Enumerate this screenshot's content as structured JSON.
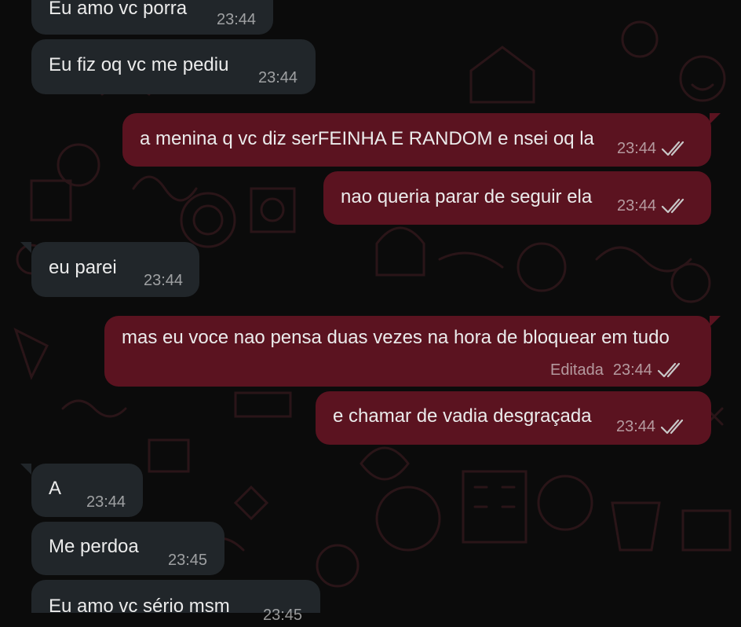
{
  "colors": {
    "background": "#0b0b0b",
    "incoming_bubble": "#21262a",
    "outgoing_bubble": "#5b1320",
    "text": "#ebebeb"
  },
  "chat": {
    "messages": [
      {
        "direction": "incoming",
        "text": "Eu amo vc porra",
        "time": "23:44"
      },
      {
        "direction": "incoming",
        "text": "Eu fiz oq vc me pediu",
        "time": "23:44"
      },
      {
        "direction": "outgoing",
        "text": "a menina q vc diz serFEINHA E RANDOM e nsei oq la",
        "time": "23:44",
        "status_icon": "double-check-icon"
      },
      {
        "direction": "outgoing",
        "text": "nao queria parar de seguir ela",
        "time": "23:44",
        "status_icon": "double-check-icon"
      },
      {
        "direction": "incoming",
        "text": "eu parei",
        "time": "23:44"
      },
      {
        "direction": "outgoing",
        "text": "mas eu voce nao pensa duas vezes na hora de bloquear em tudo",
        "edited_label": "Editada",
        "time": "23:44",
        "status_icon": "double-check-icon"
      },
      {
        "direction": "outgoing",
        "text": "e chamar de vadia desgraçada",
        "time": "23:44",
        "status_icon": "double-check-icon"
      },
      {
        "direction": "incoming",
        "text": "A",
        "time": "23:44"
      },
      {
        "direction": "incoming",
        "text": "Me perdoa",
        "time": "23:45"
      },
      {
        "direction": "incoming",
        "text": "Eu amo vc sério msm",
        "time": "23:45"
      }
    ]
  }
}
